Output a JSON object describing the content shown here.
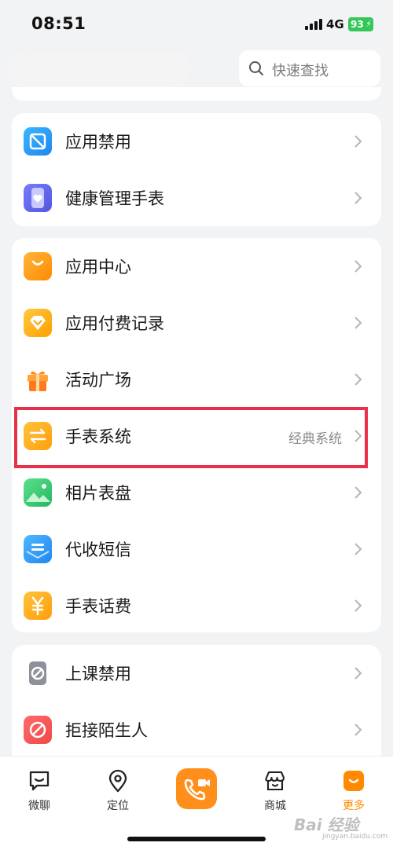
{
  "status_bar": {
    "time": "08:51",
    "network": "4G",
    "battery": "93"
  },
  "search": {
    "placeholder": "快速查找"
  },
  "groups": [
    {
      "items": [
        {
          "label": "应用禁用",
          "icon": "app-block-icon",
          "value": ""
        },
        {
          "label": "健康管理手表",
          "icon": "watch-heart-icon",
          "value": ""
        }
      ]
    },
    {
      "items": [
        {
          "label": "应用中心",
          "icon": "shopping-bag-icon",
          "value": ""
        },
        {
          "label": "应用付费记录",
          "icon": "diamond-icon",
          "value": ""
        },
        {
          "label": "活动广场",
          "icon": "gift-icon",
          "value": ""
        },
        {
          "label": "手表系统",
          "icon": "switch-arrows-icon",
          "value": "经典系统"
        },
        {
          "label": "相片表盘",
          "icon": "photo-icon",
          "value": ""
        },
        {
          "label": "代收短信",
          "icon": "message-box-icon",
          "value": ""
        },
        {
          "label": "手表话费",
          "icon": "yen-coin-icon",
          "value": ""
        }
      ]
    },
    {
      "items": [
        {
          "label": "上课禁用",
          "icon": "class-ban-icon",
          "value": ""
        },
        {
          "label": "拒接陌生人",
          "icon": "block-stranger-icon",
          "value": ""
        }
      ]
    }
  ],
  "tab_bar": {
    "tabs": [
      {
        "label": "微聊",
        "icon": "chat-icon"
      },
      {
        "label": "定位",
        "icon": "location-pin-icon"
      },
      {
        "label": "商城",
        "icon": "store-icon"
      },
      {
        "label": "更多",
        "icon": "more-icon",
        "active": true
      }
    ],
    "center_icon": "video-call-icon"
  },
  "watermark": {
    "text": "Bai 经验",
    "sub": "jingyan.baidu.com"
  },
  "colors": {
    "accent": "#ff8a00",
    "highlight": "#e9304a",
    "background": "#f2f3f5"
  }
}
